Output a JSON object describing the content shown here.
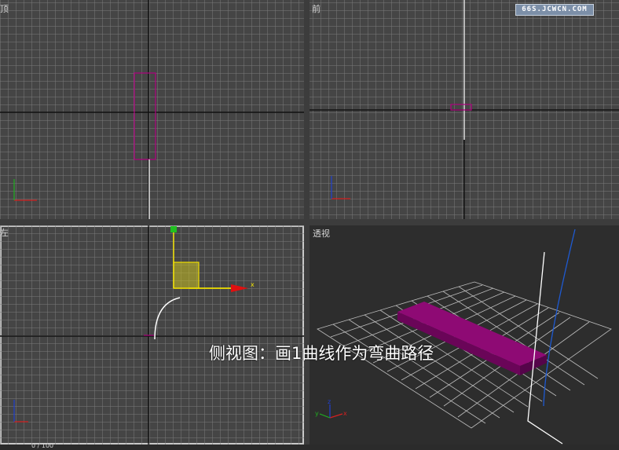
{
  "viewports": {
    "top": {
      "label": "顶"
    },
    "front": {
      "label": "前"
    },
    "left": {
      "label": "左"
    },
    "perspective": {
      "label": "透视"
    }
  },
  "watermark": "66S.JCWCN.COM",
  "caption": "侧视图：画1曲线作为弯曲路径",
  "gizmo": {
    "x_axis": "x"
  },
  "axis_tripod": {
    "x": "x",
    "y": "y",
    "z": "z"
  },
  "status": {
    "frame_text": "0 / 100"
  },
  "colors": {
    "object": "#a0007a",
    "gizmo_yellow": "#f0e000",
    "gizmo_red": "#e01010",
    "path_blue": "#1e5ad2",
    "grid": "#7d7d7d"
  }
}
